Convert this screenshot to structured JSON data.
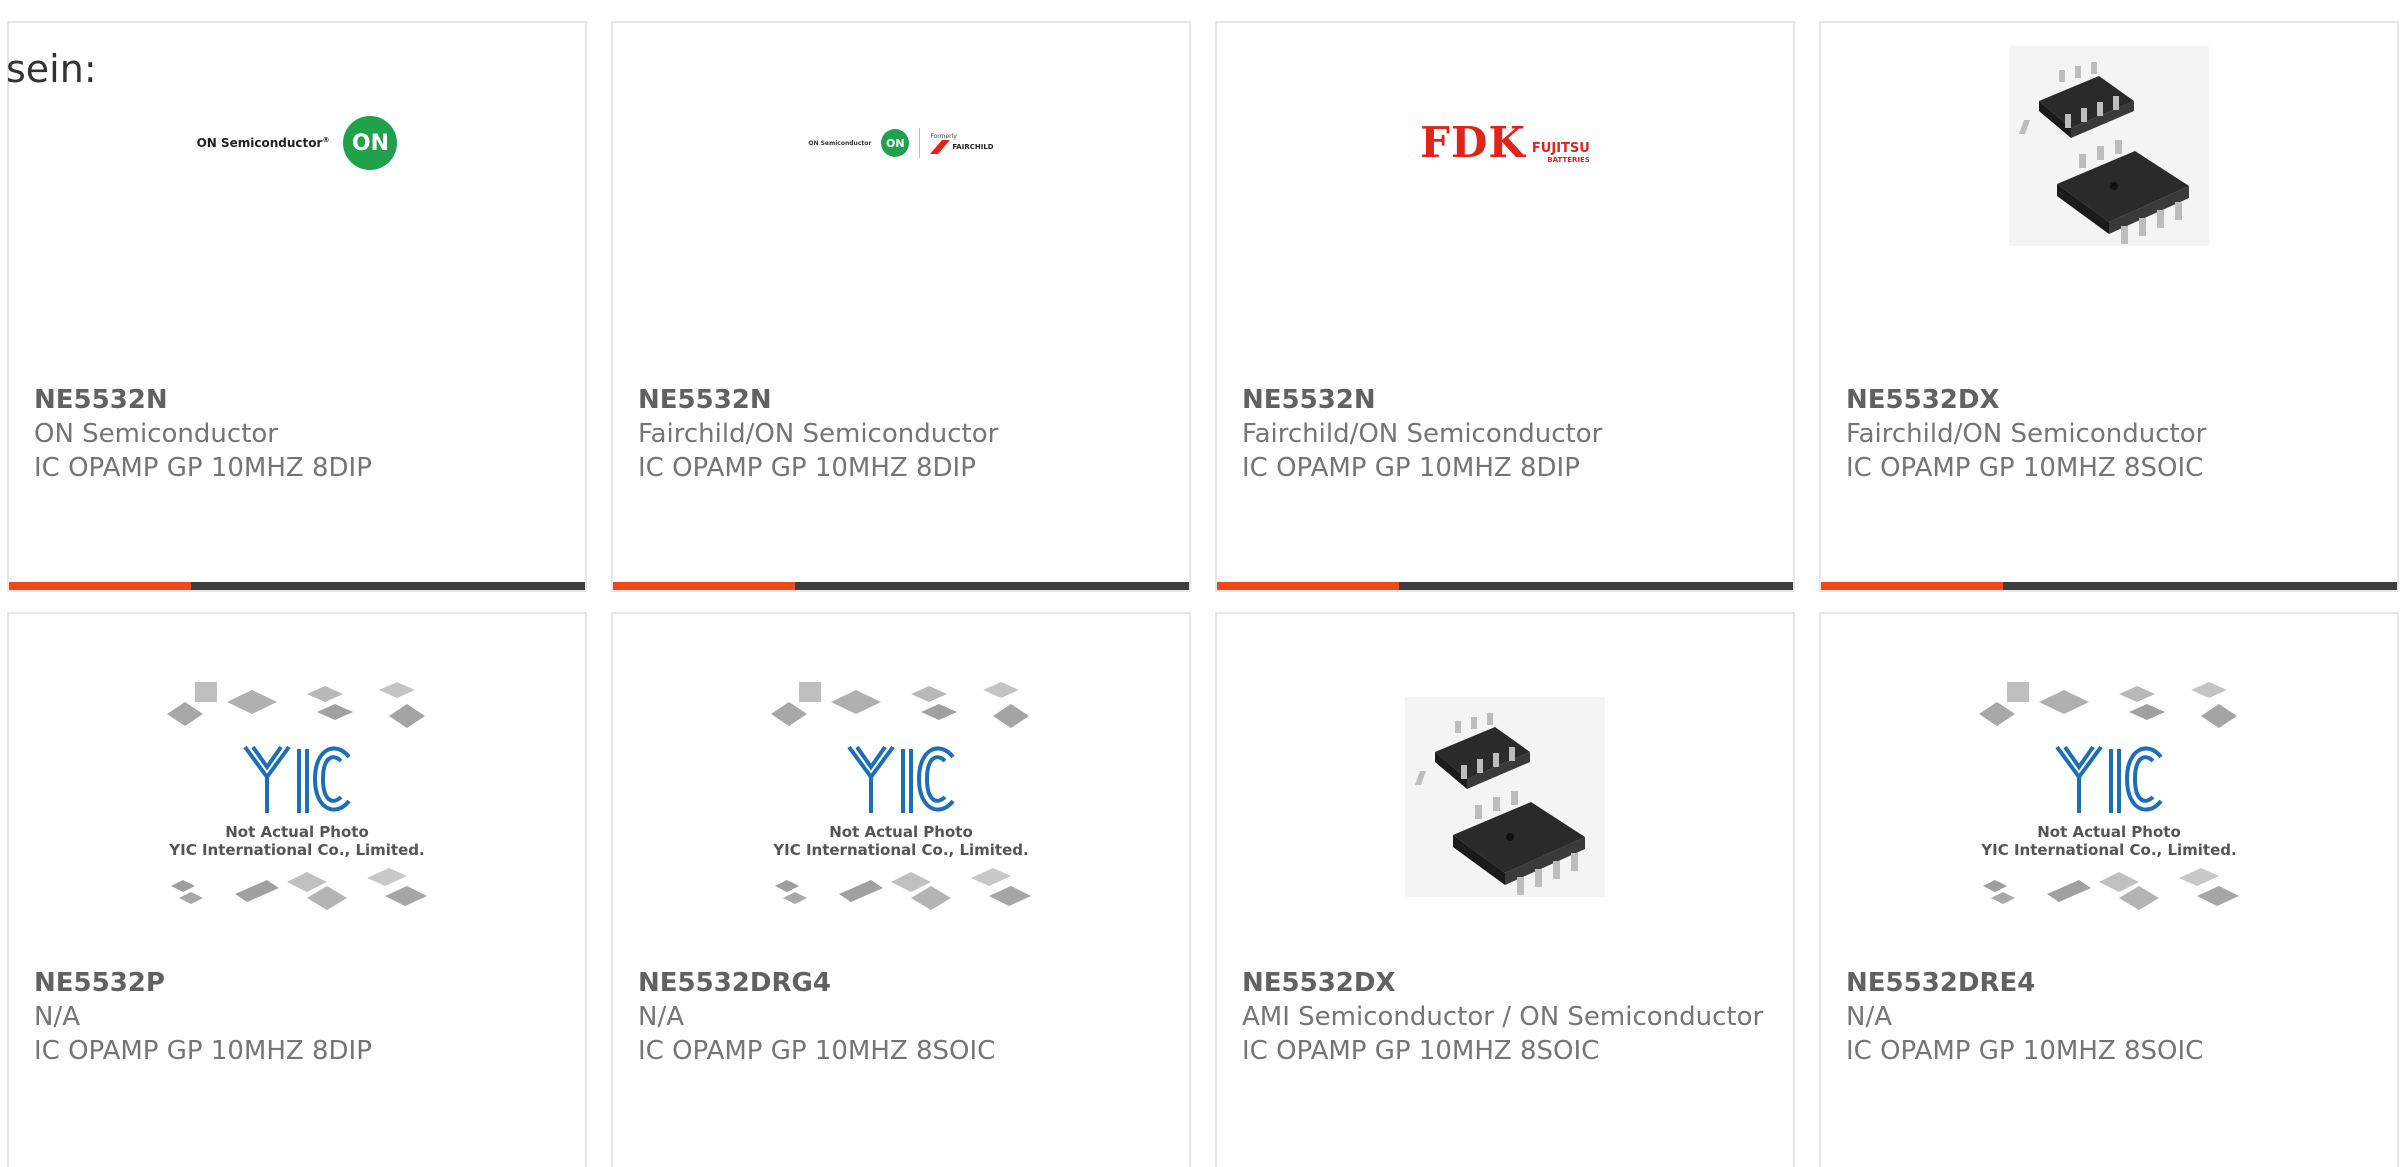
{
  "header": {
    "label": "sein:"
  },
  "colors": {
    "accent": "#ee4a19",
    "bar_dark": "#3d3d3d",
    "card_border": "#e6e6e6",
    "text": "#757575",
    "title": "#616161",
    "on_green": "#20a14c",
    "fdk_red": "#e2231a",
    "chip_dark": "#2a2a2a",
    "yic_blue": "#1c6fb7"
  },
  "cards": [
    {
      "part_number": "NE5532N",
      "manufacturer": "ON Semiconductor",
      "description": "IC OPAMP GP 10MHZ 8DIP",
      "image": "on-semiconductor-logo",
      "logo_text": "ON Semiconductor",
      "logo_reg": "®",
      "logo_badge": "ON",
      "show_bar": true
    },
    {
      "part_number": "NE5532N",
      "manufacturer": "Fairchild/ON Semiconductor",
      "description": "IC OPAMP GP 10MHZ 8DIP",
      "image": "fairchild-on-logo",
      "logo_text": "ON Semiconductor",
      "logo_badge": "ON",
      "logo_formerly": "Formerly",
      "logo_fairchild": "FAIRCHILD",
      "show_bar": true
    },
    {
      "part_number": "NE5532N",
      "manufacturer": "Fairchild/ON Semiconductor",
      "description": "IC OPAMP GP 10MHZ 8DIP",
      "image": "fdk-fujitsu-logo",
      "logo_main": "FDK",
      "logo_fujitsu": "FUJITSU",
      "logo_batteries": "BATTERIES",
      "show_bar": true
    },
    {
      "part_number": "NE5532DX",
      "manufacturer": "Fairchild/ON Semiconductor",
      "description": "IC OPAMP GP 10MHZ 8SOIC",
      "image": "soic-8-chip-photo",
      "show_bar": true
    },
    {
      "part_number": "NE5532P",
      "manufacturer": "N/A",
      "description": "IC OPAMP GP 10MHZ 8DIP",
      "image": "yic-placeholder",
      "placeholder_line1": "Not Actual Photo",
      "placeholder_line2": "YIC International Co., Limited.",
      "show_bar": false
    },
    {
      "part_number": "NE5532DRG4",
      "manufacturer": "N/A",
      "description": "IC OPAMP GP 10MHZ 8SOIC",
      "image": "yic-placeholder",
      "placeholder_line1": "Not Actual Photo",
      "placeholder_line2": "YIC International Co., Limited.",
      "show_bar": false
    },
    {
      "part_number": "NE5532DX",
      "manufacturer": "AMI Semiconductor / ON Semiconductor",
      "description": "IC OPAMP GP 10MHZ 8SOIC",
      "image": "soic-8-chip-photo",
      "show_bar": false
    },
    {
      "part_number": "NE5532DRE4",
      "manufacturer": "N/A",
      "description": "IC OPAMP GP 10MHZ 8SOIC",
      "image": "yic-placeholder",
      "placeholder_line1": "Not Actual Photo",
      "placeholder_line2": "YIC International Co., Limited.",
      "show_bar": false
    }
  ]
}
